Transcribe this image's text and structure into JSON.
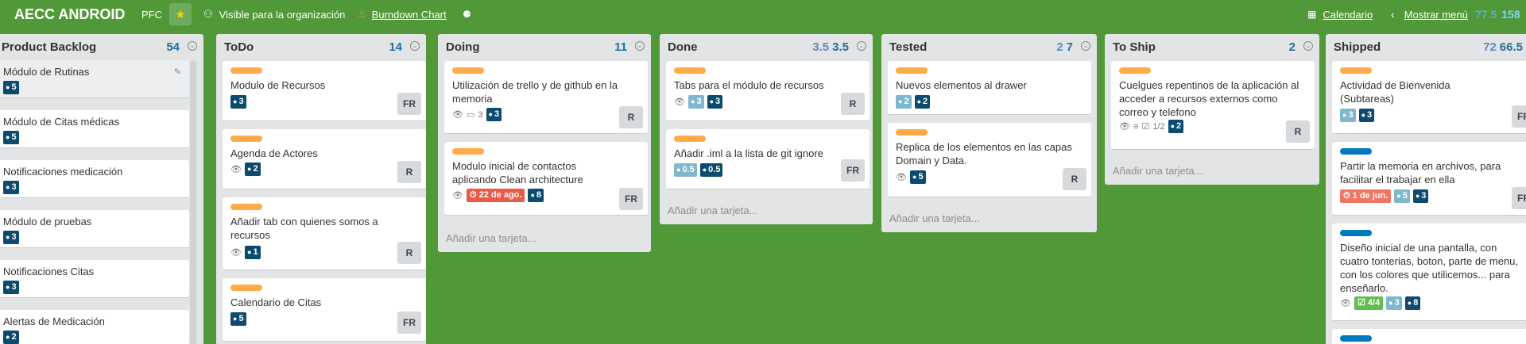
{
  "header": {
    "board_title": "AECC ANDROID",
    "org": "PFC",
    "star_icon": "star-icon",
    "visibility": "Visible para la organización",
    "burndown": "Burndown Chart",
    "calendar": "Calendario",
    "menu": "Mostrar menú",
    "points_a": "77.5",
    "points_b": "158"
  },
  "colors": {
    "board_bg": "#519839",
    "label_orange": "#ffab4a",
    "label_blue": "#0079bf",
    "badge": "#0c4a6e",
    "due_red": "#eb5a46",
    "check_green": "#61bd4f"
  },
  "lists": [
    {
      "title": "Product Backlog",
      "count": "54",
      "cards": [
        {
          "title": "Módulo de Rutinas",
          "pts": "5"
        },
        {
          "title": "Módulo de Citas médicas",
          "pts": "5"
        },
        {
          "title": "Notificaciones medicación",
          "pts": "3"
        },
        {
          "title": "Módulo de pruebas",
          "pts": "3"
        },
        {
          "title": "Notificaciones Citas",
          "pts": "3"
        },
        {
          "title": "Alertas de Medicación",
          "pts": "2"
        }
      ]
    },
    {
      "title": "ToDo",
      "count": "14",
      "cards": [
        {
          "title": "Modulo de Recursos",
          "pts": "3",
          "member": "FR"
        },
        {
          "title": "Agenda de Actores",
          "pts": "2",
          "member": "R"
        },
        {
          "title": "Añadir tab con quienes somos a recursos",
          "pts": "1",
          "member": "R"
        },
        {
          "title": "Calendario de Citas",
          "pts": "5",
          "member": "FR"
        }
      ]
    },
    {
      "title": "Doing",
      "count": "11",
      "cards": [
        {
          "title": "Utilización de trello y de github en la memoria",
          "comments": "3",
          "pts": "3",
          "member": "R"
        },
        {
          "title": "Modulo inicial de contactos aplicando Clean architecture",
          "due": "22 de ago.",
          "pts": "8",
          "member": "FR"
        }
      ],
      "add": "Añadir una tarjeta..."
    },
    {
      "title": "Done",
      "count_a": "3.5",
      "count_b": "3.5",
      "cards": [
        {
          "title": "Tabs para el módulo de recursos",
          "pts_a": "3",
          "pts": "3",
          "member": "R"
        },
        {
          "title": "Añadir .iml a la lista de git ignore",
          "pts_a": "0.5",
          "pts": "0.5",
          "member": "FR"
        }
      ],
      "add": "Añadir una tarjeta..."
    },
    {
      "title": "Tested",
      "count_a": "2",
      "count_b": "7",
      "cards": [
        {
          "title": "Nuevos elementos al drawer",
          "pts_a": "2",
          "pts": "2"
        },
        {
          "title": "Replica de los elementos en las capas Domain y Data.",
          "pts": "5",
          "member": "R"
        }
      ],
      "add": "Añadir una tarjeta..."
    },
    {
      "title": "To Ship",
      "count": "2",
      "cards": [
        {
          "title": "Cuelgues repentinos de la aplicación al acceder a recursos externos como correo y telefono",
          "checklist": "1/2",
          "pts": "2",
          "member": "R"
        }
      ],
      "add": "Añadir una tarjeta..."
    },
    {
      "title": "Shipped",
      "count_a": "72",
      "count_b": "66.5",
      "cards": [
        {
          "title": "Actividad de Bienvenida (Subtareas)",
          "pts_a": "3",
          "pts": "3",
          "member": "FR"
        },
        {
          "title": "Partir la memoria en archivos, para facilitar el trabajar en ella",
          "due": "1 de jun.",
          "pts_a": "5",
          "pts": "3",
          "member": "FR"
        },
        {
          "title": "Diseño inicial de una pantalla, con cuatro tonterias, boton, parte de menu, con los colores que utilicemos... para enseñarlo.",
          "checklist": "4/4",
          "pts_a": "3",
          "pts": "8"
        }
      ]
    }
  ]
}
